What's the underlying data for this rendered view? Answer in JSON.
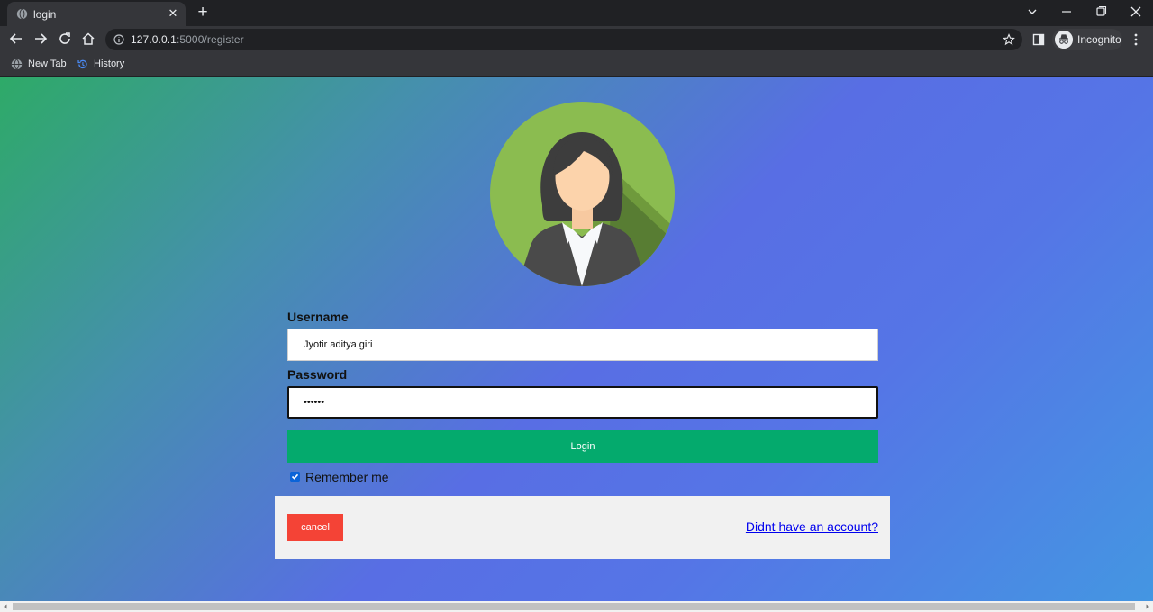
{
  "browser": {
    "tab": {
      "title": "login",
      "close_glyph": "✕",
      "favicon": "globe-icon"
    },
    "new_tab_glyph": "+",
    "address": {
      "host": "127.0.0.1",
      "rest": ":5000/register"
    },
    "profile_label": "Incognito",
    "bookmarks": [
      {
        "label": "New Tab",
        "icon": "globe-icon"
      },
      {
        "label": "History",
        "icon": "history-icon"
      }
    ]
  },
  "page": {
    "avatar": "user-avatar-woman",
    "username": {
      "label": "Username",
      "value": "Jyotir aditya giri"
    },
    "password": {
      "label": "Password",
      "value": "••••••"
    },
    "login_label": "Login",
    "remember": {
      "label": "Remember me",
      "checked": true
    },
    "cancel_label": "cancel",
    "signup_link": "Didnt have an account?"
  },
  "colors": {
    "login_button": "#04aa6d",
    "cancel_button": "#f44336",
    "link": "#0000ee",
    "footer_bg": "#f1f1f1"
  }
}
